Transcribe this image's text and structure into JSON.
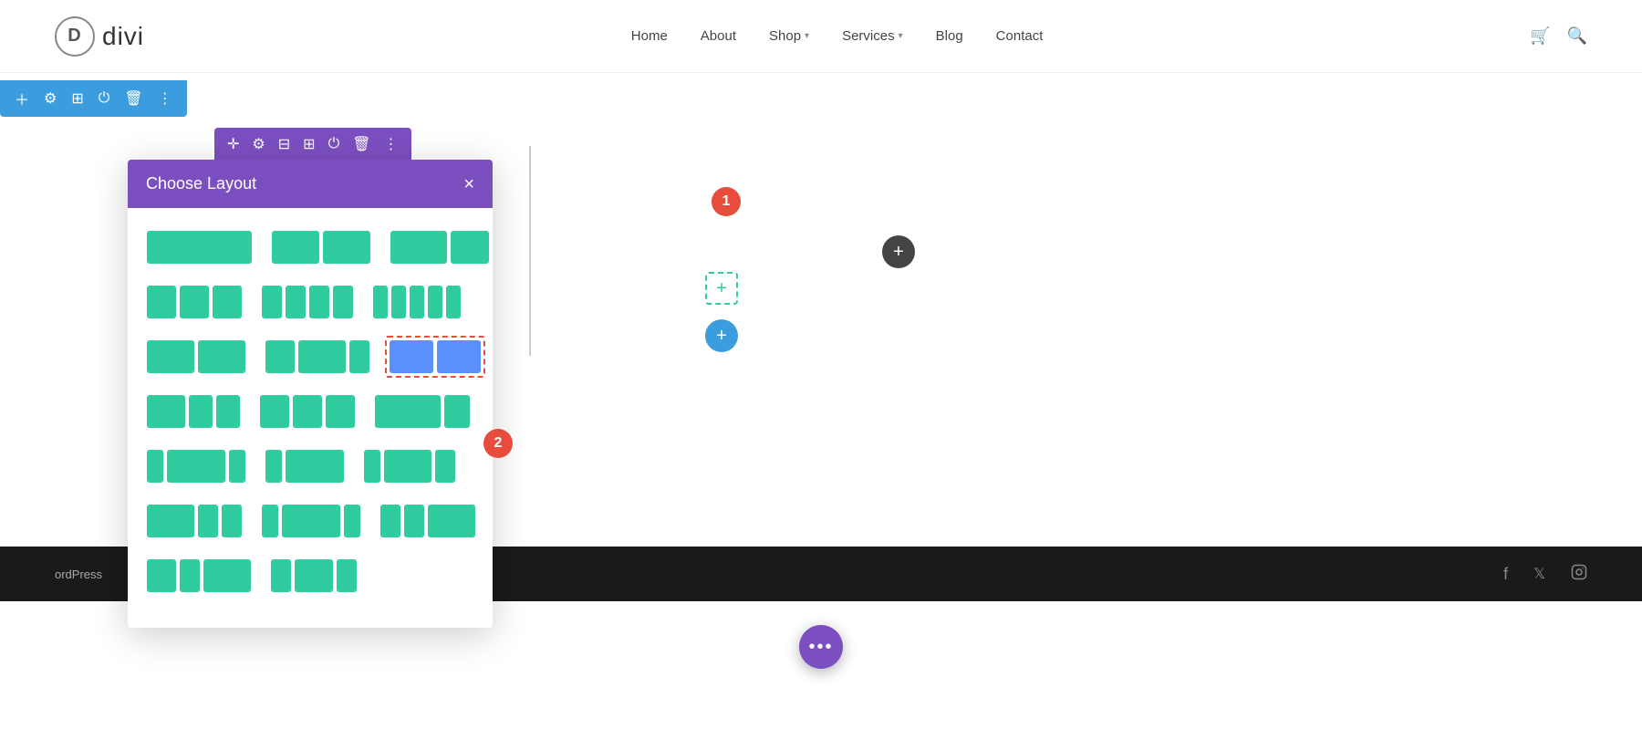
{
  "header": {
    "logo_letter": "D",
    "logo_name": "divi",
    "nav_items": [
      {
        "label": "Home",
        "has_dropdown": false
      },
      {
        "label": "About",
        "has_dropdown": false
      },
      {
        "label": "Shop",
        "has_dropdown": true
      },
      {
        "label": "Services",
        "has_dropdown": true
      },
      {
        "label": "Blog",
        "has_dropdown": false
      },
      {
        "label": "Contact",
        "has_dropdown": false
      }
    ]
  },
  "blue_toolbar": {
    "icons": [
      "plus",
      "gear",
      "layout",
      "power",
      "trash",
      "dots"
    ]
  },
  "purple_toolbar": {
    "icons": [
      "move",
      "gear",
      "layout",
      "grid",
      "power",
      "trash",
      "dots"
    ]
  },
  "modal": {
    "title": "Choose Layout",
    "close_label": "×"
  },
  "footer": {
    "text": "ordPress"
  },
  "steps": {
    "step1": "1",
    "step2": "2"
  },
  "fab": {
    "dots": "•••"
  }
}
